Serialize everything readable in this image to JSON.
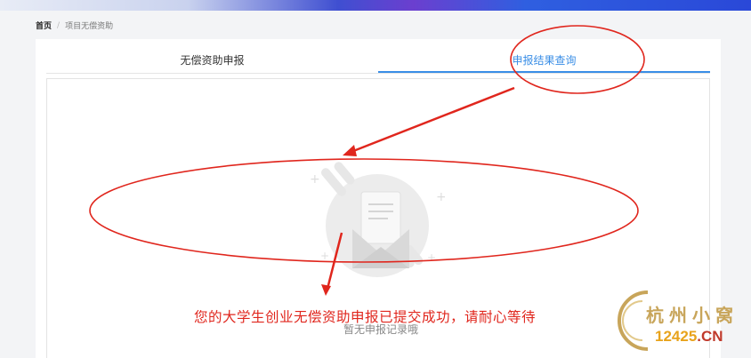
{
  "breadcrumb": {
    "home": "首页",
    "separator": "/",
    "current": "项目无偿资助"
  },
  "tabs": [
    {
      "label": "无偿资助申报",
      "active": false
    },
    {
      "label": "申报结果查询",
      "active": true
    }
  ],
  "empty_state": {
    "message": "暂无申报记录哦"
  },
  "annotation": {
    "text": "您的大学生创业无偿资助申报已提交成功，请耐心等待"
  },
  "watermark": {
    "title": "杭州小窝",
    "domain_num": "12425",
    "domain_tld": ".CN"
  },
  "colors": {
    "accent": "#3a8ee6",
    "annotation_red": "#e0261d",
    "banner_blue": "#2a48d8"
  },
  "icons": [
    "envelope-document-icon",
    "sparkle-plus-icon"
  ]
}
